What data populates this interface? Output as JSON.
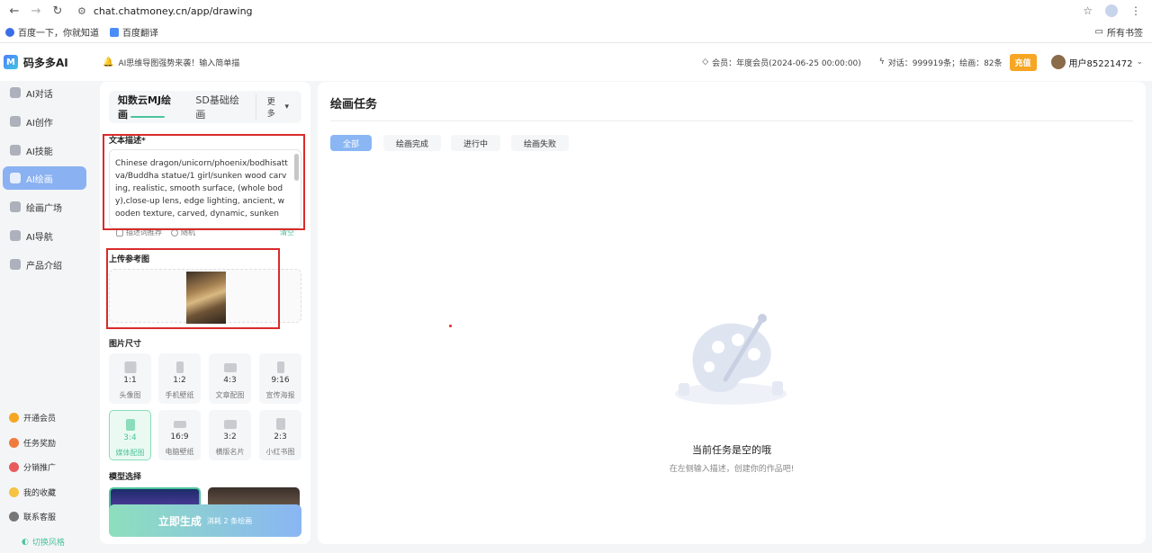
{
  "browser": {
    "url": "chat.chatmoney.cn/app/drawing",
    "bookmarks": [
      "百度一下，你就知道",
      "百度翻译"
    ],
    "all_bookmarks": "所有书签"
  },
  "topbar": {
    "logo_text": "码多多AI",
    "notice": "AI思维导图强势来袭！输入简单描",
    "membership": "会员：年度会员(2024-06-25 00:00:00)",
    "quota": "对话：999919条；绘画：82条",
    "recharge": "充值",
    "username": "用户85221472"
  },
  "sidebar": {
    "items": [
      {
        "label": "AI对话",
        "icon": "chat-icon"
      },
      {
        "label": "AI创作",
        "icon": "pen-icon"
      },
      {
        "label": "AI技能",
        "icon": "skills-icon"
      },
      {
        "label": "AI绘画",
        "icon": "palette-icon",
        "active": true
      },
      {
        "label": "绘画广场",
        "icon": "gallery-icon"
      },
      {
        "label": "AI导航",
        "icon": "grid-icon"
      },
      {
        "label": "产品介绍",
        "icon": "doc-icon"
      }
    ],
    "bottom": [
      {
        "label": "开通会员",
        "icon": "vip-icon",
        "color": "#f6a623"
      },
      {
        "label": "任务奖励",
        "icon": "reward-icon",
        "color": "#f07b3f"
      },
      {
        "label": "分销推广",
        "icon": "share-icon",
        "color": "#e85b5b"
      },
      {
        "label": "我的收藏",
        "icon": "star-icon",
        "color": "#f5c242"
      },
      {
        "label": "联系客服",
        "icon": "headset-icon",
        "color": "#555555"
      }
    ],
    "theme_switch": "切换风格"
  },
  "left_panel": {
    "tabs": [
      "知数云MJ绘画",
      "SD基础绘画"
    ],
    "more": "更多",
    "prompt_label": "文本描述*",
    "prompt_text": "Chinese dragon/unicorn/phoenix/bodhisattva/Buddha statue/1 girl/sunken wood carving, realistic, smooth surface, (whole body),close-up lens, edge lighting, ancient, wooden texture, carved, dynamic, sunken",
    "prompt_opts": [
      "描述词推荐",
      "随机"
    ],
    "clear": "清空",
    "upload_label": "上传参考图",
    "size_label": "图片尺寸",
    "sizes": [
      {
        "ratio": "1:1",
        "name": "头像图"
      },
      {
        "ratio": "1:2",
        "name": "手机壁纸"
      },
      {
        "ratio": "4:3",
        "name": "文章配图"
      },
      {
        "ratio": "9:16",
        "name": "宣传海报"
      },
      {
        "ratio": "3:4",
        "name": "媒体配图",
        "selected": true
      },
      {
        "ratio": "16:9",
        "name": "电脑壁纸"
      },
      {
        "ratio": "3:2",
        "name": "横版名片"
      },
      {
        "ratio": "2:3",
        "name": "小红书图"
      }
    ],
    "model_label": "模型选择",
    "generate": "立即生成",
    "generate_cost": "消耗 2 条绘画"
  },
  "main": {
    "title": "绘画任务",
    "filters": [
      "全部",
      "绘画完成",
      "进行中",
      "绘画失败"
    ],
    "active_filter": 0,
    "empty_title": "当前任务是空的哦",
    "empty_sub": "在左侧输入描述，创建你的作品吧!"
  },
  "colors": {
    "accent_green": "#4bc49a",
    "accent_blue": "#8ab6f4",
    "highlight_red": "#d92b2b",
    "recharge": "#f6a623"
  }
}
